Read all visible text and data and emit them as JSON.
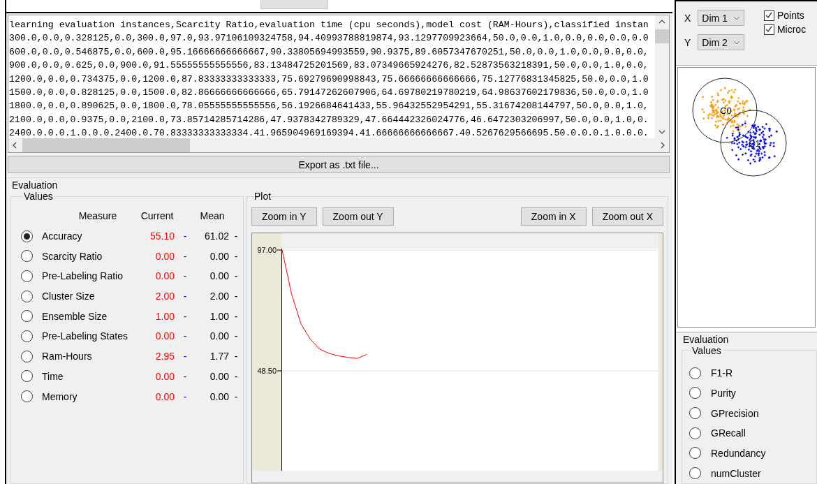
{
  "text_output": {
    "lines": [
      "learning evaluation instances,Scarcity Ratio,evaluation time (cpu seconds),model cost (RAM-Hours),classified instan",
      "300.0,0.0,0.328125,0.0,300.0,97.0,93.97106109324758,94.40993788819874,93.1297709923664,50.0,0.0,1.0,0.0,0.0,0.0,0.0",
      "600.0,0.0,0.546875,0.0,600.0,95.16666666666667,90.33805694993559,90.9375,89.6057347670251,50.0,0.0,1.0,0.0,0.0,0.0,",
      "900.0,0.0,0.625,0.0,900.0,91.55555555555556,83.13484725201569,83.07349665924276,82.52873563218391,50.0,0.0,1.0,0.0,",
      "1200.0,0.0,0.734375,0.0,1200.0,87.83333333333333,75.69279690998843,75.66666666666666,75.12776831345825,50.0,0.0,1.0",
      "1500.0,0.0,0.828125,0.0,1500.0,82.86666666666666,65.79147262607906,64.69780219780219,64.98637602179836,50.0,0.0,1.0",
      "1800.0,0.0,0.890625,0.0,1800.0,78.05555555555556,56.1926684641433,55.96432552954291,55.31674208144797,50.0,0.0,1.0,",
      "2100.0,0.0,0.9375,0.0,2100.0,73.85714285714286,47.9378342789329,47.664442326024776,46.6472303206997,50.0,0.0,1.0,0.",
      "2400.0.0.0.1.0.0.0.2400.0.70.83333333333334.41.965904969169394.41.66666666666667.40.5267629566695.50.0.0.0.1.0.0.0."
    ]
  },
  "export_button": "Export as .txt file...",
  "evaluation": {
    "title": "Evaluation",
    "values": {
      "title": "Values",
      "columns": [
        "Measure",
        "Current",
        "Mean"
      ],
      "rows": [
        {
          "measure": "Accuracy",
          "current": "55.10",
          "current_sep": "-",
          "mean": "61.02",
          "mean_sep": "-",
          "selected": true
        },
        {
          "measure": "Scarcity Ratio",
          "current": "0.00",
          "current_sep": "-",
          "mean": "0.00",
          "mean_sep": "-",
          "selected": false
        },
        {
          "measure": "Pre-Labeling Ratio",
          "current": "0.00",
          "current_sep": "-",
          "mean": "0.00",
          "mean_sep": "-",
          "selected": false
        },
        {
          "measure": "Cluster Size",
          "current": "2.00",
          "current_sep": "-",
          "mean": "2.00",
          "mean_sep": "-",
          "selected": false
        },
        {
          "measure": "Ensemble Size",
          "current": "1.00",
          "current_sep": "-",
          "mean": "1.00",
          "mean_sep": "-",
          "selected": false
        },
        {
          "measure": "Pre-Labeling States",
          "current": "0.00",
          "current_sep": "-",
          "mean": "0.00",
          "mean_sep": "-",
          "selected": false
        },
        {
          "measure": "Ram-Hours",
          "current": "2.95",
          "current_sep": "-",
          "mean": "1.77",
          "mean_sep": "-",
          "selected": false
        },
        {
          "measure": "Time",
          "current": "0.00",
          "current_sep": "-",
          "mean": "0.00",
          "mean_sep": "-",
          "selected": false
        },
        {
          "measure": "Memory",
          "current": "0.00",
          "current_sep": "-",
          "mean": "0.00",
          "mean_sep": "-",
          "selected": false
        }
      ]
    },
    "plot": {
      "title": "Plot",
      "buttons": [
        "Zoom in Y",
        "Zoom out Y",
        "Zoom in X",
        "Zoom out X"
      ],
      "chart_data": {
        "type": "line",
        "categories": [
          null,
          null,
          null,
          null,
          null,
          null,
          null,
          null,
          null,
          null,
          null,
          null,
          null,
          null,
          null,
          null,
          null,
          null,
          null,
          null,
          null,
          null,
          null,
          null,
          null,
          null,
          null,
          null,
          null,
          null,
          null,
          null,
          null,
          null,
          null,
          null,
          null,
          null,
          null,
          null,
          null
        ],
        "ylim": [
          8.4,
          97
        ],
        "yticks": [
          {
            "value": 97,
            "label": "97.00"
          },
          {
            "value": 48.5,
            "label": "48.50"
          }
        ],
        "series": [
          {
            "color": "#ff0000",
            "values": [
              97,
              79.4,
              67.3,
              61.2,
              57.2,
              55.5,
              54.5,
              53.9,
              53.5,
              55.1,
              null,
              null,
              null,
              null,
              null,
              null,
              null,
              null,
              null,
              null,
              null,
              null,
              null,
              null,
              null,
              null,
              null,
              null,
              null,
              null,
              null,
              null,
              null,
              null,
              null,
              null,
              null,
              null,
              null,
              null,
              null
            ]
          }
        ]
      }
    }
  },
  "cluster_view": {
    "x_label": "X",
    "x_dim": "Dim 1",
    "y_label": "Y",
    "y_dim": "Dim 2",
    "checkboxes": [
      {
        "label": "Points",
        "checked": true
      },
      {
        "label": "Microc",
        "checked": true
      }
    ],
    "clusters": [
      {
        "label": "C0",
        "color": "#ff9900"
      },
      {
        "label": "C1",
        "color": "#0000ff"
      }
    ]
  },
  "right_evaluation": {
    "title": "Evaluation",
    "values_title": "Values",
    "items": [
      {
        "label": "F1-R",
        "selected": false
      },
      {
        "label": "Purity",
        "selected": false
      },
      {
        "label": "GPrecision",
        "selected": false
      },
      {
        "label": "GRecall",
        "selected": false
      },
      {
        "label": "Redundancy",
        "selected": false
      },
      {
        "label": "numCluster",
        "selected": false
      }
    ]
  }
}
